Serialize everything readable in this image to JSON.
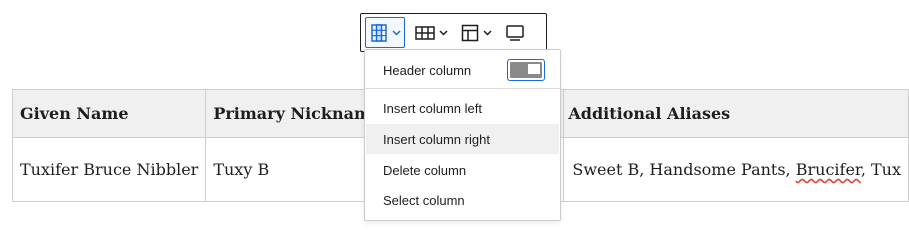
{
  "toolbar": {
    "buttons": [
      {
        "icon": "table-column-icon",
        "state": "active",
        "has_dropdown": true
      },
      {
        "icon": "table-grid-icon",
        "has_dropdown": true
      },
      {
        "icon": "table-layout-icon",
        "has_dropdown": true
      },
      {
        "icon": "monitor-icon",
        "has_dropdown": false
      }
    ],
    "accent_color": "#1b6bd6"
  },
  "column_menu": {
    "header_column_label": "Header column",
    "header_column_enabled": true,
    "items": [
      {
        "label": "Insert column left"
      },
      {
        "label": "Insert column right",
        "hovered": true
      },
      {
        "label": "Delete column"
      },
      {
        "label": "Select column"
      }
    ]
  },
  "table": {
    "headers": [
      "Given Name",
      "Primary Nickname",
      "",
      "Additional Aliases"
    ],
    "rows": [
      {
        "given_name": "Tuxifer Bruce Nibbler",
        "primary_nickname": "Tuxy B",
        "col3": "",
        "aliases_prefix": "Sweet B, Handsome Pants, ",
        "aliases_misspelled": "Brucifer",
        "aliases_suffix": ", Tux"
      }
    ]
  }
}
